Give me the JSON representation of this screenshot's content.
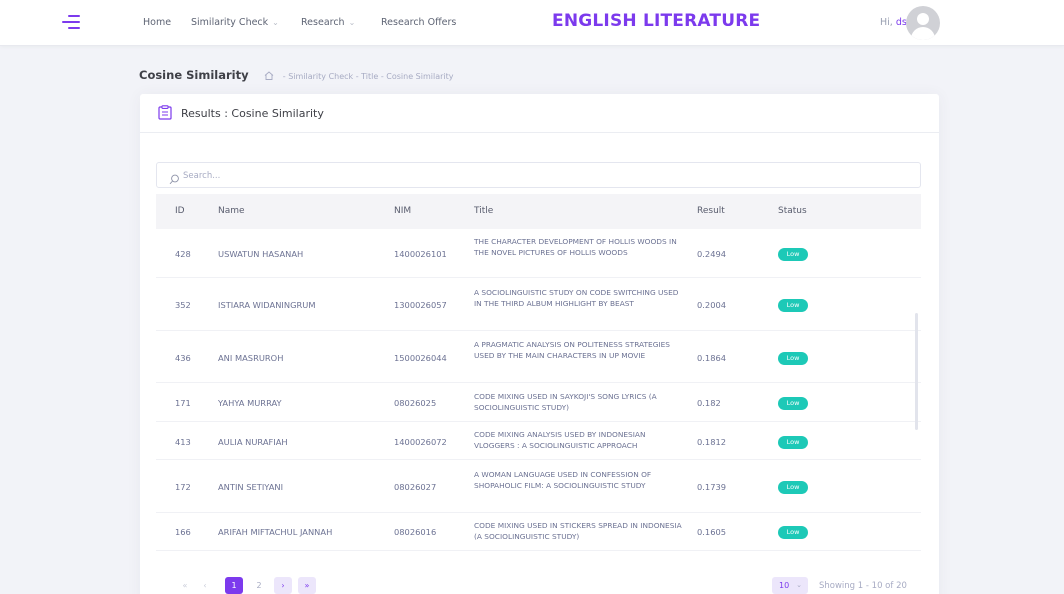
{
  "nav": {
    "brand": "ENGLISH LITERATURE",
    "links": [
      "Home",
      "Similarity Check",
      "Research",
      "Research Offers"
    ],
    "greeting": "Hi,",
    "username": "dsn"
  },
  "subheader": {
    "title": "Cosine Similarity",
    "breadcrumb": "- Similarity Check - Title - Cosine Similarity"
  },
  "card": {
    "title": "Results : Cosine Similarity",
    "search_placeholder": "Search..."
  },
  "table": {
    "columns": [
      "ID",
      "Name",
      "NIM",
      "Title",
      "Result",
      "Status"
    ],
    "rows": [
      {
        "id": "428",
        "name": "USWATUN HASANAH",
        "nim": "1400026101",
        "title": "THE CHARACTER DEVELOPMENT OF HOLLIS WOODS IN THE NOVEL PICTURES OF HOLLIS WOODS",
        "result": "0.2494",
        "status": "Low"
      },
      {
        "id": "352",
        "name": "ISTIARA WIDANINGRUM",
        "nim": "1300026057",
        "title": "A SOCIOLINGUISTIC STUDY ON CODE SWITCHING USED IN THE THIRD ALBUM HIGHLIGHT BY BEAST",
        "result": "0.2004",
        "status": "Low"
      },
      {
        "id": "436",
        "name": "ANI MASRUROH",
        "nim": "1500026044",
        "title": "A PRAGMATIC ANALYSIS ON POLITENESS STRATEGIES USED BY THE MAIN CHARACTERS IN UP MOVIE",
        "result": "0.1864",
        "status": "Low"
      },
      {
        "id": "171",
        "name": "YAHYA MURRAY",
        "nim": "08026025",
        "title": "CODE MIXING USED IN SAYKOJI'S SONG LYRICS (A SOCIOLINGUISTIC STUDY)",
        "result": "0.182",
        "status": "Low"
      },
      {
        "id": "413",
        "name": "AULIA NURAFIAH",
        "nim": "1400026072",
        "title": "CODE MIXING ANALYSIS USED BY INDONESIAN VLOGGERS : A SOCIOLINGUISTIC APPROACH",
        "result": "0.1812",
        "status": "Low"
      },
      {
        "id": "172",
        "name": "ANTIN SETIYANI",
        "nim": "08026027",
        "title": "A WOMAN LANGUAGE USED IN CONFESSION OF SHOPAHOLIC FILM: A SOCIOLINGUISTIC STUDY",
        "result": "0.1739",
        "status": "Low"
      },
      {
        "id": "166",
        "name": "ARIFAH MIFTACHUL JANNAH",
        "nim": "08026016",
        "title": "CODE MIXING USED IN STICKERS SPREAD IN INDONESIA (A SOCIOLINGUISTIC STUDY)",
        "result": "0.1605",
        "status": "Low"
      }
    ]
  },
  "pagination": {
    "first": "«",
    "prev": "‹",
    "pages": [
      "1",
      "2"
    ],
    "next": "›",
    "last": "»",
    "page_size": "10",
    "showing": "Showing 1 - 10 of 20"
  },
  "colors": {
    "accent": "#7c3aed",
    "badge_low": "#1dc9b7"
  }
}
